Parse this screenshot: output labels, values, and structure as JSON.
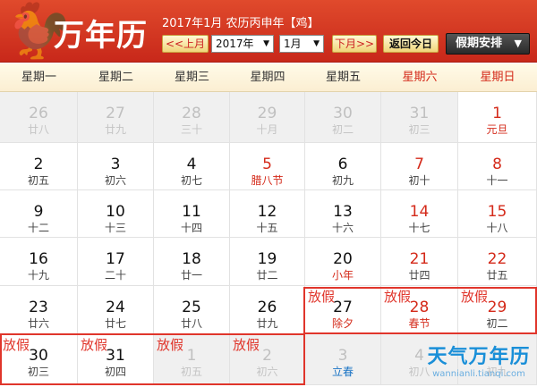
{
  "header": {
    "title": "万年历",
    "lunar_info": "2017年1月 农历丙申年【鸡】",
    "prev_month": "<<上月",
    "year_select": "2017年",
    "month_select": "1月",
    "next_month": "下月>>",
    "today": "返回今日",
    "holiday_schedule": "假期安排"
  },
  "weekdays": [
    "星期一",
    "星期二",
    "星期三",
    "星期四",
    "星期五",
    "星期六",
    "星期日"
  ],
  "calendar_rows": [
    [
      {
        "day": "26",
        "lunar": "廿八",
        "other": true
      },
      {
        "day": "27",
        "lunar": "廿九",
        "other": true
      },
      {
        "day": "28",
        "lunar": "三十",
        "other": true
      },
      {
        "day": "29",
        "lunar": "十月",
        "other": true
      },
      {
        "day": "30",
        "lunar": "初二",
        "other": true
      },
      {
        "day": "31",
        "lunar": "初三",
        "other": true
      },
      {
        "day": "1",
        "lunar": "元旦",
        "day_red": true,
        "lunar_red": true
      }
    ],
    [
      {
        "day": "2",
        "lunar": "初五"
      },
      {
        "day": "3",
        "lunar": "初六"
      },
      {
        "day": "4",
        "lunar": "初七"
      },
      {
        "day": "5",
        "lunar": "腊八节",
        "day_red": true,
        "lunar_red": true
      },
      {
        "day": "6",
        "lunar": "初九"
      },
      {
        "day": "7",
        "lunar": "初十",
        "day_red": true
      },
      {
        "day": "8",
        "lunar": "十一",
        "day_red": true
      }
    ],
    [
      {
        "day": "9",
        "lunar": "十二"
      },
      {
        "day": "10",
        "lunar": "十三"
      },
      {
        "day": "11",
        "lunar": "十四"
      },
      {
        "day": "12",
        "lunar": "十五"
      },
      {
        "day": "13",
        "lunar": "十六"
      },
      {
        "day": "14",
        "lunar": "十七",
        "day_red": true
      },
      {
        "day": "15",
        "lunar": "十八",
        "day_red": true
      }
    ],
    [
      {
        "day": "16",
        "lunar": "十九"
      },
      {
        "day": "17",
        "lunar": "二十"
      },
      {
        "day": "18",
        "lunar": "廿一"
      },
      {
        "day": "19",
        "lunar": "廿二"
      },
      {
        "day": "20",
        "lunar": "小年",
        "lunar_red": true
      },
      {
        "day": "21",
        "lunar": "廿四",
        "day_red": true
      },
      {
        "day": "22",
        "lunar": "廿五",
        "day_red": true
      }
    ],
    [
      {
        "day": "23",
        "lunar": "廿六"
      },
      {
        "day": "24",
        "lunar": "廿七"
      },
      {
        "day": "25",
        "lunar": "廿八"
      },
      {
        "day": "26",
        "lunar": "廿九"
      },
      {
        "day": "27",
        "lunar": "除夕",
        "lunar_red": true,
        "tag": "放假"
      },
      {
        "day": "28",
        "lunar": "春节",
        "day_red": true,
        "lunar_red": true,
        "tag": "放假"
      },
      {
        "day": "29",
        "lunar": "初二",
        "day_red": true,
        "tag": "放假"
      }
    ],
    [
      {
        "day": "30",
        "lunar": "初三",
        "tag": "放假"
      },
      {
        "day": "31",
        "lunar": "初四",
        "tag": "放假"
      },
      {
        "day": "1",
        "lunar": "初五",
        "other": true,
        "tag": "放假"
      },
      {
        "day": "2",
        "lunar": "初六",
        "other": true,
        "tag": "放假"
      },
      {
        "day": "3",
        "lunar": "立春",
        "other": true,
        "lunar_blue": true
      },
      {
        "day": "4",
        "lunar": "初八",
        "other": true
      },
      {
        "day": "5",
        "lunar": "初九",
        "other": true
      }
    ]
  ],
  "watermark": {
    "main": "天气万年历",
    "sub": "wannianli.tianqi.com"
  },
  "colors": {
    "header_red": "#c8281a",
    "holiday_red": "#d42a1a",
    "solar_term_blue": "#1a73c4",
    "watermark_blue": "#1a8fd8"
  }
}
